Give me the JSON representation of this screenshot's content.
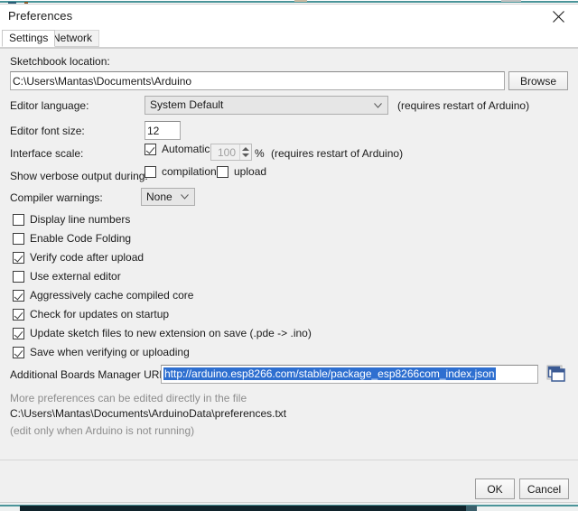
{
  "window": {
    "title": "Preferences",
    "close_icon": "close-icon"
  },
  "tabs": [
    {
      "label": "Settings",
      "active": true
    },
    {
      "label": "Network",
      "active": false
    }
  ],
  "settings": {
    "sketchbook": {
      "label": "Sketchbook location:",
      "value": "C:\\Users\\Mantas\\Documents\\Arduino",
      "browse_label": "Browse"
    },
    "editor_language": {
      "label": "Editor language:",
      "value": "System Default",
      "note": "(requires restart of Arduino)"
    },
    "editor_font_size": {
      "label": "Editor font size:",
      "value": "12"
    },
    "interface_scale": {
      "label": "Interface scale:",
      "automatic_label": "Automatic",
      "automatic_checked": true,
      "scale_value": "100",
      "percent_label": "%",
      "note": "(requires restart of Arduino)"
    },
    "verbose_output": {
      "label": "Show verbose output during:",
      "compilation_label": "compilation",
      "compilation_checked": false,
      "upload_label": "upload",
      "upload_checked": false
    },
    "compiler_warnings": {
      "label": "Compiler warnings:",
      "value": "None"
    },
    "checkboxes": [
      {
        "label": "Display line numbers",
        "checked": false
      },
      {
        "label": "Enable Code Folding",
        "checked": false
      },
      {
        "label": "Verify code after upload",
        "checked": true
      },
      {
        "label": "Use external editor",
        "checked": false
      },
      {
        "label": "Aggressively cache compiled core",
        "checked": true
      },
      {
        "label": "Check for updates on startup",
        "checked": true
      },
      {
        "label": "Update sketch files to new extension on save (.pde -> .ino)",
        "checked": true
      },
      {
        "label": "Save when verifying or uploading",
        "checked": true
      }
    ],
    "boards_urls": {
      "label": "Additional Boards Manager URLs:",
      "value": "http://arduino.esp8266.com/stable/package_esp8266com_index.json",
      "icon": "open-window-icon"
    },
    "footnote": {
      "line1": "More preferences can be edited directly in the file",
      "line2": "C:\\Users\\Mantas\\Documents\\ArduinoData\\preferences.txt",
      "line3": "(edit only when Arduino is not running)"
    }
  },
  "footer": {
    "ok_label": "OK",
    "cancel_label": "Cancel"
  },
  "colors": {
    "selection_blue": "#2e6fd0",
    "accent_teal": "#4a9499",
    "dialog_bg": "#f0f0f0"
  }
}
